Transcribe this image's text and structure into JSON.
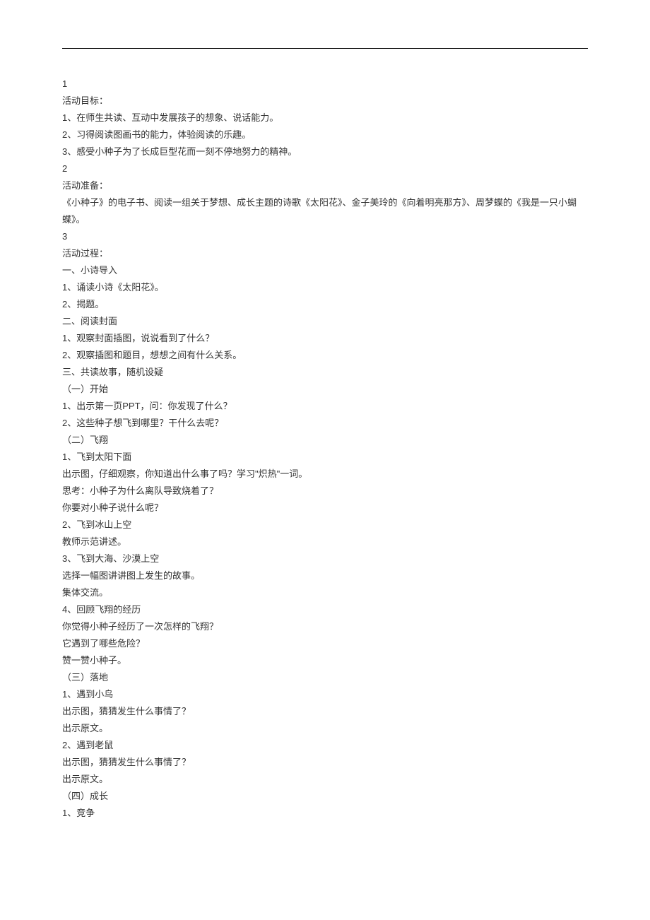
{
  "sections": [
    {
      "num": "1",
      "heading": "活动目标：",
      "lines": [
        "1、在师生共读、互动中发展孩子的想象、说话能力。",
        "2、习得阅读图画书的能力，体验阅读的乐趣。",
        "3、感受小种子为了长成巨型花而一刻不停地努力的精神。"
      ]
    },
    {
      "num": "2",
      "heading": "活动准备：",
      "lines": [
        "《小种子》的电子书、阅读一组关于梦想、成长主题的诗歌《太阳花》、金子美玲的《向着明亮那方》、周梦蝶的《我是一只小蝴蝶》。"
      ]
    },
    {
      "num": "3",
      "heading": "活动过程：",
      "lines": [
        "一、小诗导入",
        "1、诵读小诗《太阳花》。",
        "2、揭题。",
        "二、阅读封面",
        "1、观察封面插图，说说看到了什么？",
        "2、观察插图和题目，想想之间有什么关系。",
        "三、共读故事，随机设疑",
        "（一）开始",
        "1、出示第一页PPT，问：你发现了什么？",
        "2、这些种子想飞到哪里？干什么去呢？",
        "（二）飞翔",
        "1、飞到太阳下面",
        "出示图，仔细观察，你知道出什么事了吗？学习\"炽热\"一词。",
        "思考：小种子为什么离队导致烧着了？",
        "你要对小种子说什么呢？",
        "2、飞到冰山上空",
        "教师示范讲述。",
        "3、飞到大海、沙漠上空",
        "选择一幅图讲讲图上发生的故事。",
        "集体交流。",
        "4、回顾飞翔的经历",
        "你觉得小种子经历了一次怎样的飞翔？",
        "它遇到了哪些危险？",
        "赞一赞小种子。",
        "（三）落地",
        "1、遇到小鸟",
        "出示图，猜猜发生什么事情了？",
        "出示原文。",
        "2、遇到老鼠",
        "出示图，猜猜发生什么事情了？",
        "出示原文。",
        "（四）成长",
        "1、竞争"
      ]
    }
  ]
}
